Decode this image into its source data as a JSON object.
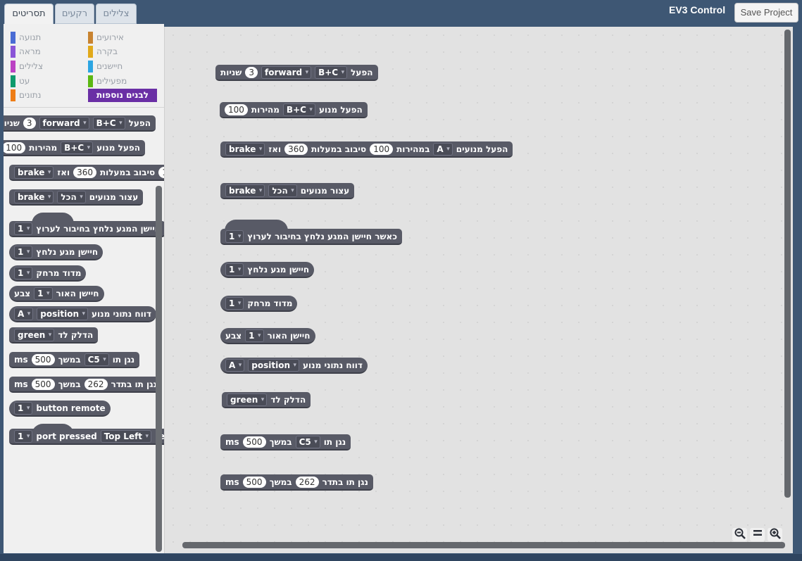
{
  "tabs": [
    {
      "label": "תסריטים"
    },
    {
      "label": "רקעים"
    },
    {
      "label": "צלילים"
    }
  ],
  "app_title": "EV3 Control",
  "save_label": "Save Project",
  "categories": [
    {
      "label": "אירועים",
      "color": "#c88330"
    },
    {
      "label": "תנועה",
      "color": "#4a6cd4"
    },
    {
      "label": "בקרה",
      "color": "#e1a91a"
    },
    {
      "label": "מראה",
      "color": "#8a55d7"
    },
    {
      "label": "חיישנים",
      "color": "#2ca5e2"
    },
    {
      "label": "צלילים",
      "color": "#bb42c3"
    },
    {
      "label": "מפעילים",
      "color": "#5cb712"
    },
    {
      "label": "עט",
      "color": "#0e9a6c"
    },
    {
      "label": "נתונים",
      "color": "#ee7d16"
    }
  ],
  "more_blocks_label": "לבנים נוספות",
  "words": {
    "run": "הפעל",
    "seconds": "שניות",
    "run_motor": "הפעל מנוע",
    "speed": "מהירות",
    "run_motors": "הפעל מנועים",
    "at_speed": "במהירות",
    "rotate_degrees": "סיבוב במעלות",
    "and_then": "ואז",
    "stop_motors": "עצור מנועים",
    "when_touch": "כאשר חיישן המגע נלחץ בחיבור לערוץ",
    "touch_pressed": "חיישן מגע נלחץ",
    "measure_distance": "מדוד מרחק",
    "light_sensor": "חיישן האור",
    "color": "צבע",
    "motor_data": "דווח נתוני מנוע",
    "led_on": "הדלק לד",
    "play_note": "נגן תו",
    "for_duration": "במשך",
    "play_freq": "נגן תו בתדר",
    "palette_when_touch": "חיישן המגע נלחץ בחיבור לערוץ",
    "remote_partial": "rem"
  },
  "values": {
    "three": "3",
    "forward": "forward",
    "bc": "B+C",
    "hundred": "100",
    "a": "A",
    "degrees": "360",
    "brake": "brake",
    "all": "הכל",
    "one": "1",
    "position": "position",
    "green": "green",
    "ms": "ms",
    "five_hundred": "500",
    "c5": "C5",
    "freq": "262",
    "button_remote": "button remote",
    "port_pressed": "port pressed",
    "top_left": "Top Left"
  }
}
